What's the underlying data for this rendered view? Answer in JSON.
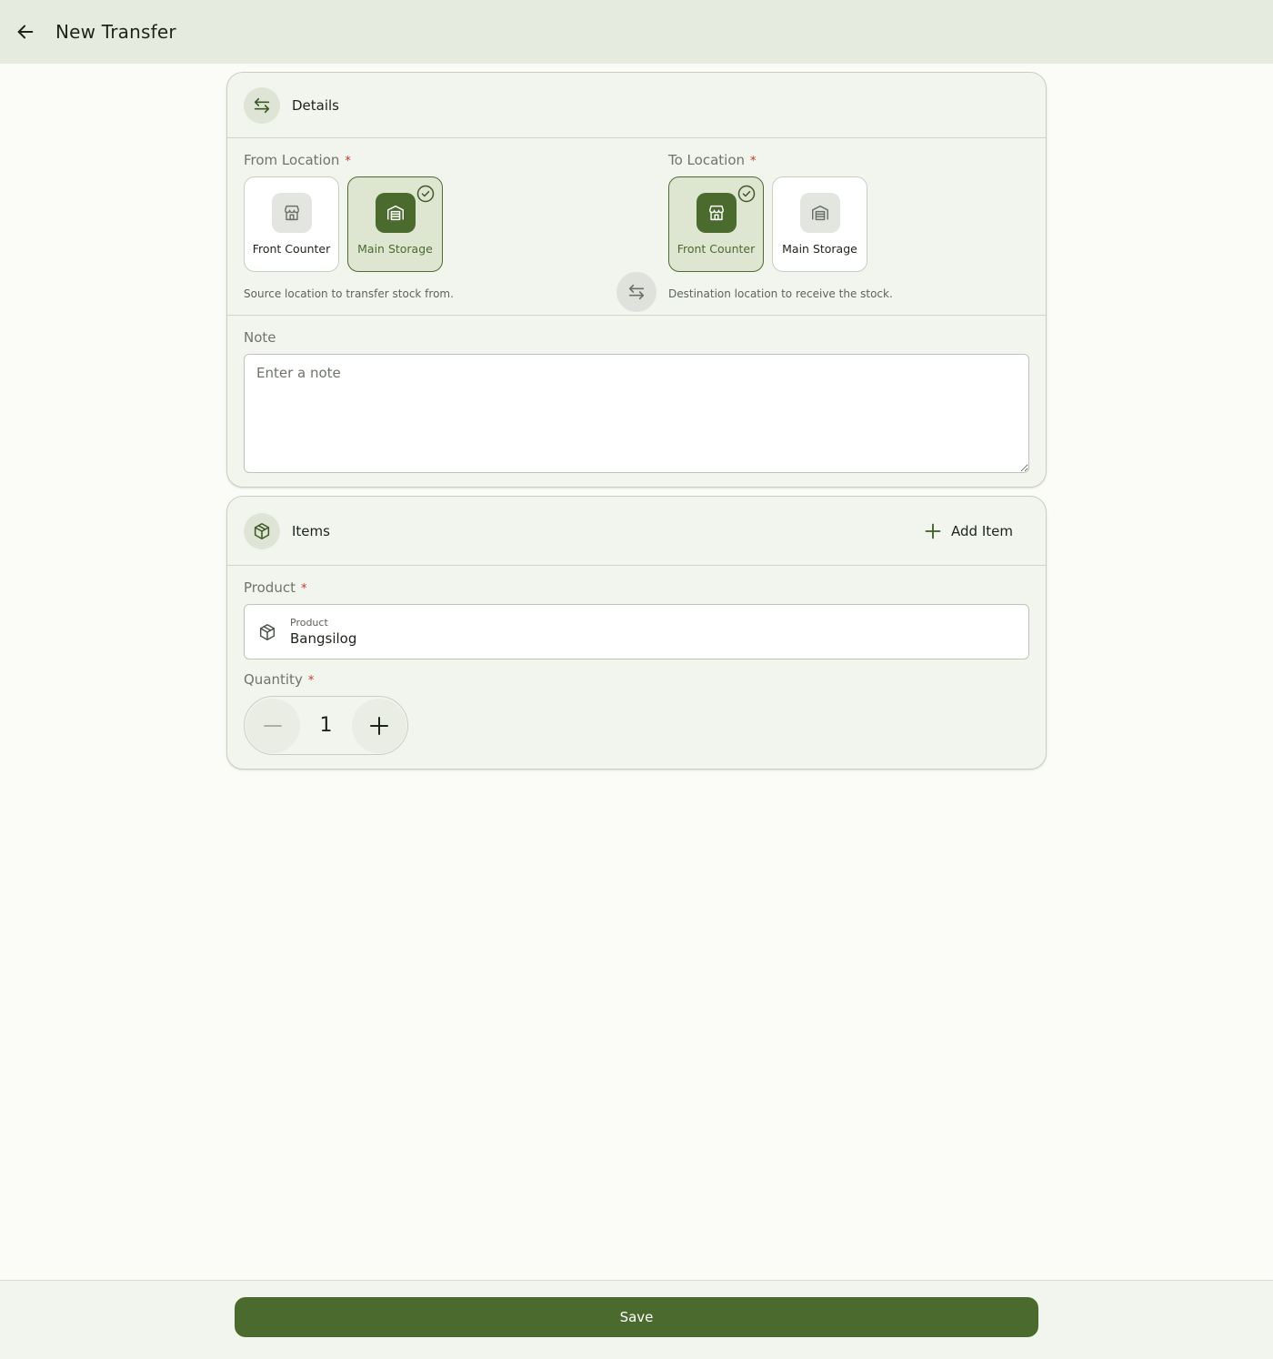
{
  "appbar": {
    "title": "New Transfer"
  },
  "details": {
    "header": "Details",
    "from": {
      "label": "From Location",
      "required": "*",
      "options": [
        {
          "label": "Front Counter",
          "selected": false
        },
        {
          "label": "Main Storage",
          "selected": true
        }
      ],
      "helper": "Source location to transfer stock from."
    },
    "to": {
      "label": "To Location",
      "required": "*",
      "options": [
        {
          "label": "Front Counter",
          "selected": true
        },
        {
          "label": "Main Storage",
          "selected": false
        }
      ],
      "helper": "Destination location to receive the stock."
    },
    "note": {
      "label": "Note",
      "placeholder": "Enter a note",
      "value": ""
    }
  },
  "items": {
    "header": "Items",
    "add_label": "Add Item",
    "product": {
      "label": "Product",
      "required": "*",
      "field_label": "Product",
      "value": "Bangsilog"
    },
    "quantity": {
      "label": "Quantity",
      "required": "*",
      "value": "1"
    }
  },
  "footer": {
    "save_label": "Save"
  },
  "colors": {
    "primary": "#4b6a2e",
    "appbar": "#e6ebe0",
    "card": "#f2f5ed",
    "required": "#c0392b"
  },
  "icons": {
    "back": "arrow-left-icon",
    "details": "swap-arrows-icon",
    "front_counter": "storefront-icon",
    "main_storage": "warehouse-icon",
    "selected": "check-circle-icon",
    "items": "package-icon",
    "add": "plus-icon",
    "minus": "minus-icon"
  }
}
